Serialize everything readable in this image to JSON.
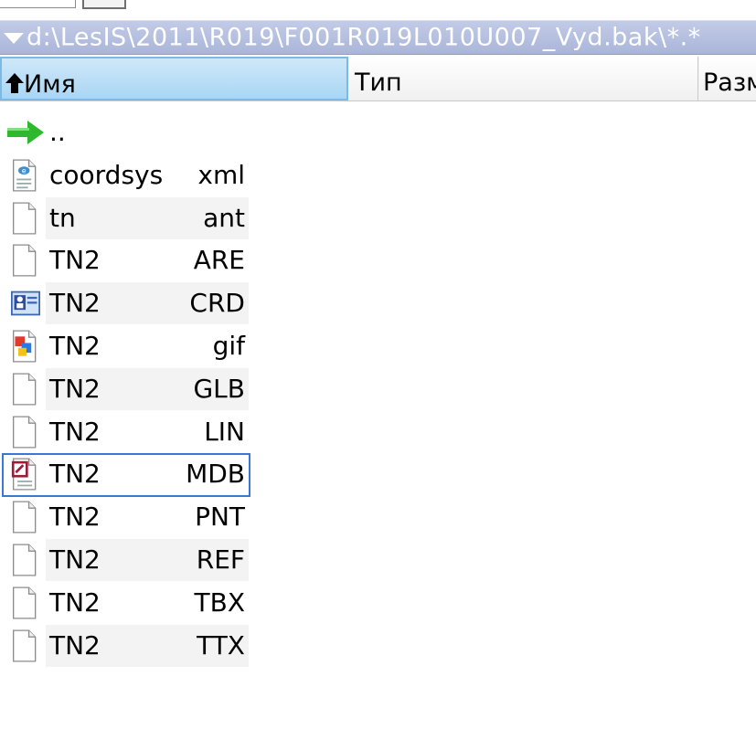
{
  "path_bar": {
    "path": "d:\\LesIS\\2011\\R019\\F001R019L010U007_Vyd.bak\\*.*"
  },
  "columns": {
    "name": "Имя",
    "type": "Тип",
    "size": "Разм"
  },
  "updir": {
    "label": ".."
  },
  "files": [
    {
      "name": "coordsys",
      "ext": "xml",
      "icon": "xml-file-icon"
    },
    {
      "name": "tn",
      "ext": "ant",
      "icon": "generic-file-icon"
    },
    {
      "name": "TN2",
      "ext": "ARE",
      "icon": "generic-file-icon"
    },
    {
      "name": "TN2",
      "ext": "CRD",
      "icon": "contact-card-icon"
    },
    {
      "name": "TN2",
      "ext": "gif",
      "icon": "image-file-icon"
    },
    {
      "name": "TN2",
      "ext": "GLB",
      "icon": "generic-file-icon"
    },
    {
      "name": "TN2",
      "ext": "LIN",
      "icon": "generic-file-icon"
    },
    {
      "name": "TN2",
      "ext": "MDB",
      "icon": "access-db-icon",
      "selected": true
    },
    {
      "name": "TN2",
      "ext": "PNT",
      "icon": "generic-file-icon"
    },
    {
      "name": "TN2",
      "ext": "REF",
      "icon": "generic-file-icon"
    },
    {
      "name": "TN2",
      "ext": "TBX",
      "icon": "generic-file-icon"
    },
    {
      "name": "TN2",
      "ext": "TTX",
      "icon": "generic-file-icon"
    }
  ],
  "colors": {
    "path_bar_bg": "#aab5d9",
    "selected_header_bg": "#a9d6f4",
    "selection_border": "#3a78d6",
    "updir_arrow": "#2db82d"
  }
}
